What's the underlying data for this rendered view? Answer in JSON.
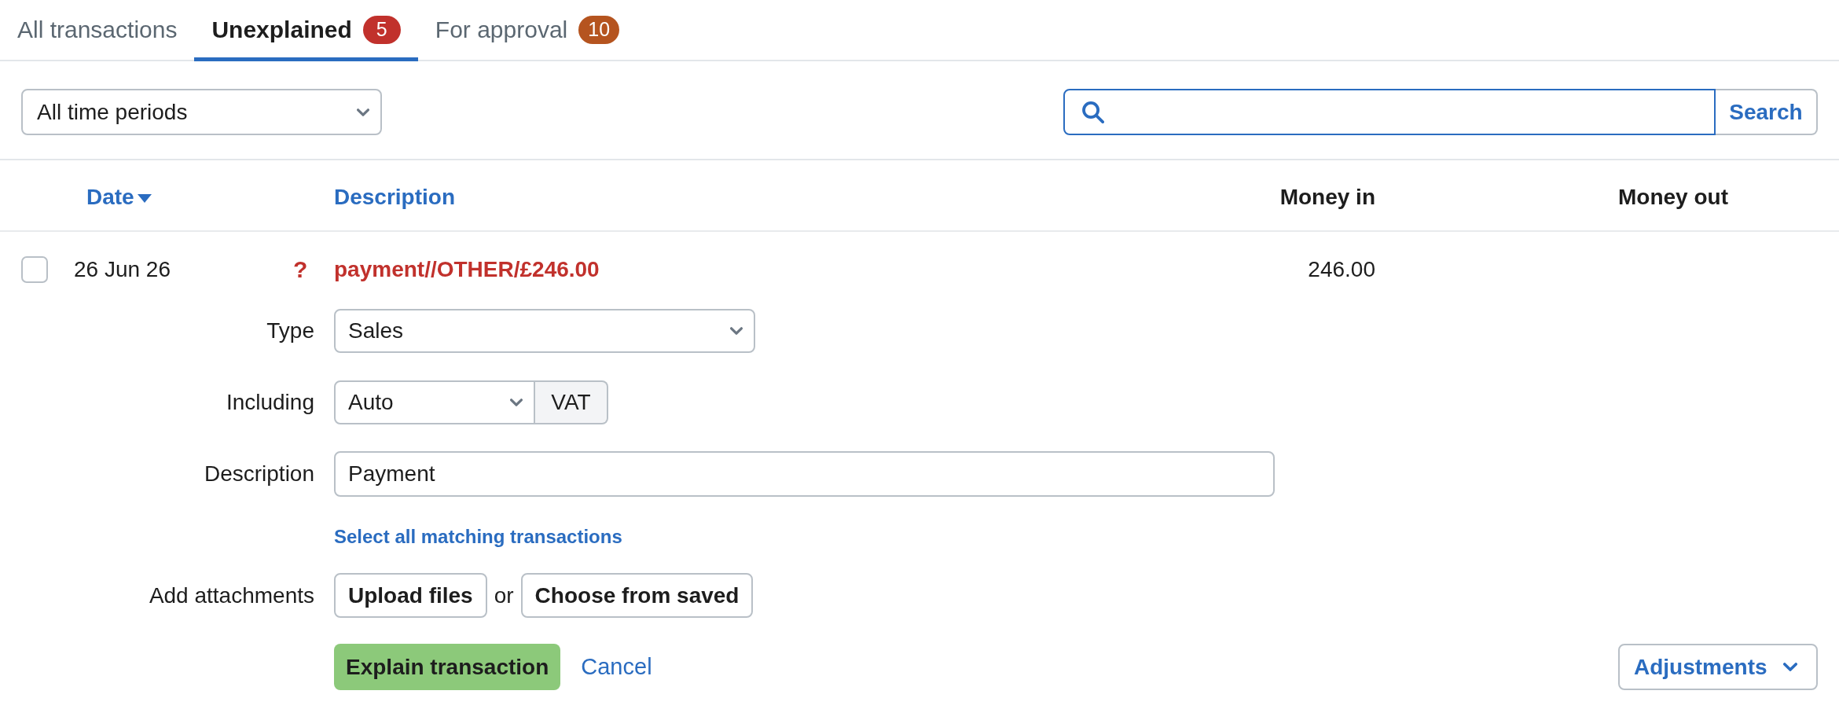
{
  "tabs": [
    {
      "label": "All transactions",
      "selected": false
    },
    {
      "label": "Unexplained",
      "selected": true,
      "badge": {
        "count": "5",
        "color": "#c1312c"
      }
    },
    {
      "label": "For approval",
      "selected": false,
      "badge": {
        "count": "10",
        "color": "#b5541f"
      }
    }
  ],
  "filters": {
    "period": "All time periods",
    "search_button": "Search"
  },
  "table": {
    "columns": [
      {
        "label": "Date",
        "sortable": true,
        "sorted": true
      },
      {
        "label": "Description",
        "sortable": true,
        "sorted": false
      },
      {
        "label": "Money in",
        "sortable": false,
        "sorted": false
      },
      {
        "label": "Money out",
        "sortable": false,
        "sorted": false
      }
    ],
    "rows": [
      {
        "checked": false,
        "date": "26 Jun 26",
        "flag": "?",
        "description": "payment//OTHER/£246.00",
        "money_in": "246.00"
      }
    ]
  },
  "explain_form": {
    "fields": [
      {
        "kind": "select",
        "label": "Type",
        "value": "Sales"
      },
      {
        "kind": "select_addon",
        "label": "Including",
        "value": "Auto",
        "addon": "VAT"
      },
      {
        "kind": "text",
        "label": "Description",
        "value": "Payment"
      }
    ],
    "matching_link": "Select all matching transactions",
    "attachments": {
      "label": "Add attachments",
      "buttons": [
        "Upload files",
        "Choose from saved"
      ],
      "separator": "or"
    },
    "actions": {
      "submit": "Explain transaction",
      "cancel": "Cancel",
      "adjustments": "Adjustments"
    }
  }
}
